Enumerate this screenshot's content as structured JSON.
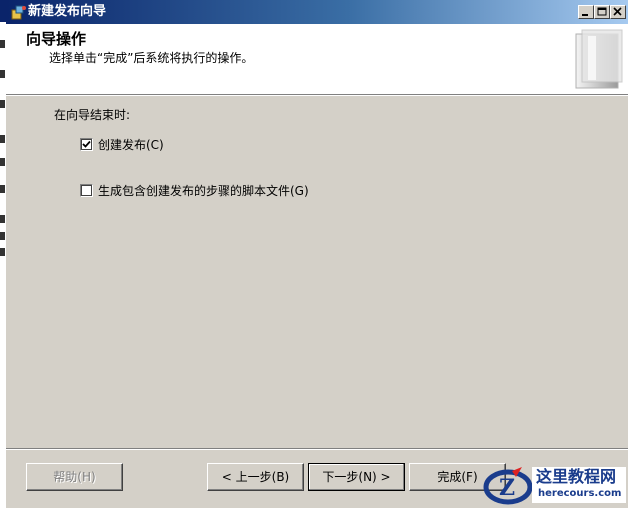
{
  "window": {
    "title": "新建发布向导"
  },
  "header": {
    "title": "向导操作",
    "subtitle": "选择单击“完成”后系统将执行的操作。"
  },
  "body": {
    "prompt": "在向导结束时:",
    "options": [
      {
        "label": "创建发布(C)",
        "checked": true
      },
      {
        "label": "生成包含创建发布的步骤的脚本文件(G)",
        "checked": false
      }
    ]
  },
  "buttons": {
    "help": "帮助(H)",
    "back": "< 上一步(B)",
    "next": "下一步(N) >",
    "finish": "完成(F)"
  },
  "watermark": {
    "title": "这里教程网",
    "url": "herecours.com"
  },
  "colors": {
    "titlebar_start": "#0a246a",
    "titlebar_end": "#a6caf0",
    "face": "#d4d0c8",
    "watermark": "#1a3c8c"
  }
}
